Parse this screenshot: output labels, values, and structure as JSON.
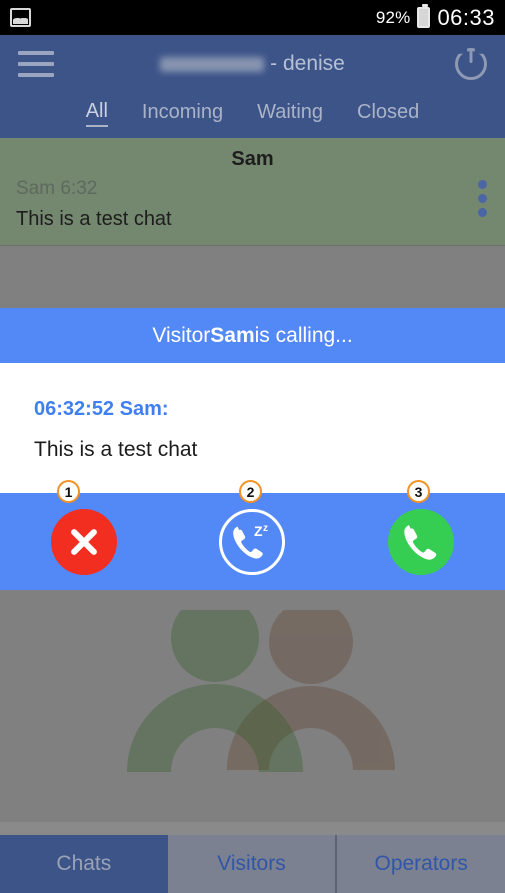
{
  "statusbar": {
    "notification_icon": "image-icon",
    "battery_percent": "92%",
    "battery_icon": "battery-icon",
    "time": "06:33"
  },
  "appbar": {
    "menu_icon": "hamburger-menu-icon",
    "title_redacted": "█████████",
    "title_suffix": " - denise",
    "power_icon": "power-icon",
    "tabs": [
      {
        "label": "All",
        "active": true
      },
      {
        "label": "Incoming",
        "active": false
      },
      {
        "label": "Waiting",
        "active": false
      },
      {
        "label": "Closed",
        "active": false
      }
    ]
  },
  "chat_list": {
    "items": [
      {
        "title": "Sam",
        "subtitle": "Sam 6:32",
        "preview": "This is a test chat",
        "menu_icon": "kebab-menu-icon",
        "selected": true
      }
    ]
  },
  "calling_banner": {
    "prefix": "Visitor ",
    "visitor_name": "Sam",
    "suffix": " is calling...",
    "background": "#5289f7"
  },
  "transcript": {
    "messages": [
      {
        "header": "06:32:52 Sam:",
        "body": "This is a test chat"
      }
    ]
  },
  "annotations": [
    {
      "number": "1",
      "target": "reject-call-button",
      "color": "#f29224"
    },
    {
      "number": "2",
      "target": "snooze-call-button",
      "color": "#f29224"
    },
    {
      "number": "3",
      "target": "answer-call-button",
      "color": "#f29224"
    }
  ],
  "call_actions": [
    {
      "name": "reject-call-button",
      "icon": "close-icon",
      "color": "#f22e21"
    },
    {
      "name": "snooze-call-button",
      "icon": "phone-snooze-icon",
      "color": "#ffffff"
    },
    {
      "name": "answer-call-button",
      "icon": "phone-icon",
      "color": "#35ce52"
    }
  ],
  "watermark": {
    "icon": "two-people-logo",
    "color_left": "#6f8f6a",
    "color_right": "#97786a"
  },
  "bottom_nav": [
    {
      "label": "Chats",
      "active": true
    },
    {
      "label": "Visitors",
      "active": false
    },
    {
      "label": "Operators",
      "active": false
    }
  ],
  "theme": {
    "appbar": "#3c5488",
    "accent_blue": "#5289f7",
    "chat_selected": "#74876f",
    "background_gray": "#808080"
  }
}
